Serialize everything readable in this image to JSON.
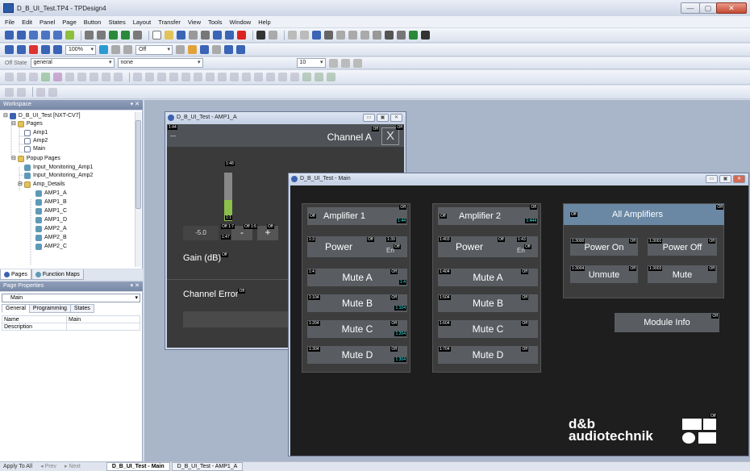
{
  "window": {
    "title": "D_B_UI_Test.TP4 - TPDesign4",
    "controls": [
      "—",
      "▢",
      "✕"
    ]
  },
  "menu": [
    "File",
    "Edit",
    "Panel",
    "Page",
    "Button",
    "States",
    "Layout",
    "Transfer",
    "View",
    "Tools",
    "Window",
    "Help"
  ],
  "toolbar": {
    "zoom": "100%",
    "state_mode": "Off",
    "state_label": "Off State",
    "state_value": "general",
    "font_value": "none",
    "font_size": "10"
  },
  "workspace": {
    "header": "Workspace",
    "project": "D_B_UI_Test [NXT-CV7]",
    "pages_folder": "Pages",
    "pages": [
      "Amp1",
      "Amp2",
      "Main"
    ],
    "popup_folder": "Popup Pages",
    "popups": [
      "Input_Monitoring_Amp1",
      "Input_Monitoring_Amp2"
    ],
    "amp_details_folder": "Amp_Details",
    "amp_details": [
      "AMP1_A",
      "AMP1_B",
      "AMP1_C",
      "AMP1_D",
      "AMP2_A",
      "AMP2_B",
      "AMP2_C"
    ],
    "tabs": [
      "Pages",
      "Function Maps"
    ]
  },
  "page_properties": {
    "header": "Page Properties",
    "selected": "Main",
    "tabs": [
      "General",
      "Programming",
      "States"
    ],
    "rows": [
      {
        "name": "Name",
        "value": "Main"
      },
      {
        "name": "Description",
        "value": ""
      }
    ]
  },
  "statusbar": {
    "apply": "Apply To All",
    "prev": "Prev",
    "next": "Next",
    "doc_tabs": [
      "D_B_UI_Test - Main",
      "D_B_UI_Test - AMP1_A"
    ]
  },
  "amp1a_window": {
    "title": "D_B_UI_Test - AMP1_A",
    "header_tag": "1:44",
    "header_dots": "---",
    "channel_label": "Channel A",
    "close_glyph": "X",
    "meter_tag": "1:48",
    "meter_low_tag": "1:1",
    "meter_level": 0.43,
    "gain_value": "-5.0",
    "gain_tag": "1:47",
    "gain_minus": "-",
    "gain_plus": "+",
    "tag_off1": "Off 1:7",
    "tag_off2": "Off 1:6",
    "tag_off3": "Off",
    "gain_label": "Gain (dB)",
    "error_label": "Channel Error",
    "off": "Off"
  },
  "main_window": {
    "title": "D_B_UI_Test - Main",
    "amp1": {
      "header": "Amplifier 1",
      "header_tag": "1:44",
      "power": "Power",
      "power_tag": "1:3",
      "power_side_tag": "1:39",
      "err": "Err",
      "mutes": [
        {
          "label": "Mute A",
          "tag": "1:4",
          "side": "1:4"
        },
        {
          "label": "Mute B",
          "tag": "1:104",
          "side": "1:104"
        },
        {
          "label": "Mute C",
          "tag": "1:204",
          "side": "1:204"
        },
        {
          "label": "Mute D",
          "tag": "1:304",
          "side": "1:304"
        }
      ]
    },
    "amp2": {
      "header": "Amplifier 2",
      "header_tag": "1:444",
      "power": "Power",
      "power_tag": "1:403",
      "power_side_tag": "1:43",
      "err": "Err",
      "mutes": [
        {
          "label": "Mute A",
          "tag": "1:404"
        },
        {
          "label": "Mute B",
          "tag": "1:504"
        },
        {
          "label": "Mute C",
          "tag": "1:604"
        },
        {
          "label": "Mute D",
          "tag": "1:704"
        }
      ]
    },
    "all": {
      "header": "All Amplifiers",
      "power_on": "Power On",
      "power_on_tag": "1:3000",
      "power_off": "Power Off",
      "power_off_tag": "1:3001",
      "unmute": "Unmute",
      "unmute_tag": "1:3004",
      "mute": "Mute",
      "mute_tag": "1:3003"
    },
    "module_info": "Module Info",
    "logo_line1": "d&b",
    "logo_line2": "audiotechnik",
    "off": "Off"
  }
}
